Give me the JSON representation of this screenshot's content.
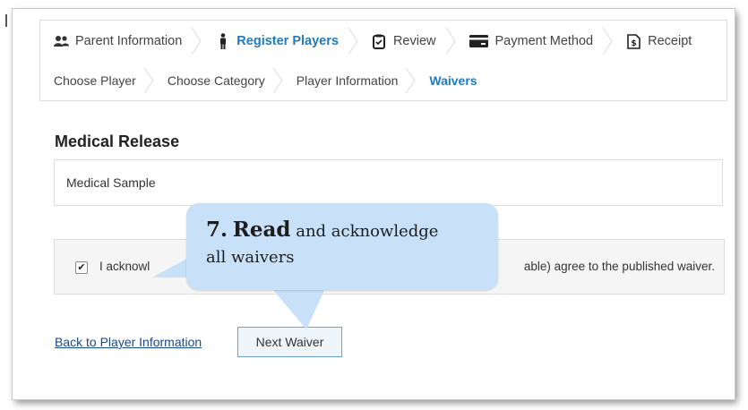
{
  "steps": [
    {
      "label": "Parent Information",
      "icon": "users-icon",
      "active": false
    },
    {
      "label": "Register Players",
      "icon": "person-icon",
      "active": true
    },
    {
      "label": "Review",
      "icon": "clipboard-icon",
      "active": false
    },
    {
      "label": "Payment Method",
      "icon": "credit-card-icon",
      "active": false
    },
    {
      "label": "Receipt",
      "icon": "receipt-icon",
      "active": false
    }
  ],
  "substeps": [
    {
      "label": "Choose Player",
      "active": false
    },
    {
      "label": "Choose Category",
      "active": false
    },
    {
      "label": "Player Information",
      "active": false
    },
    {
      "label": "Waivers",
      "active": true
    }
  ],
  "section": {
    "title": "Medical Release",
    "waiver_name": "Medical Sample"
  },
  "acknowledge": {
    "checked": true,
    "text_visible_start": "I acknowl",
    "text_visible_end": "able) agree to the published waiver."
  },
  "actions": {
    "back_label": "Back to Player Information",
    "next_label": "Next Waiver"
  },
  "callout": {
    "number": "7.",
    "bold_word": "Read",
    "rest_line1": "and acknowledge",
    "line2": "all waivers"
  },
  "colors": {
    "accent": "#1f7bc1",
    "callout_bg": "#c8e1f9"
  }
}
